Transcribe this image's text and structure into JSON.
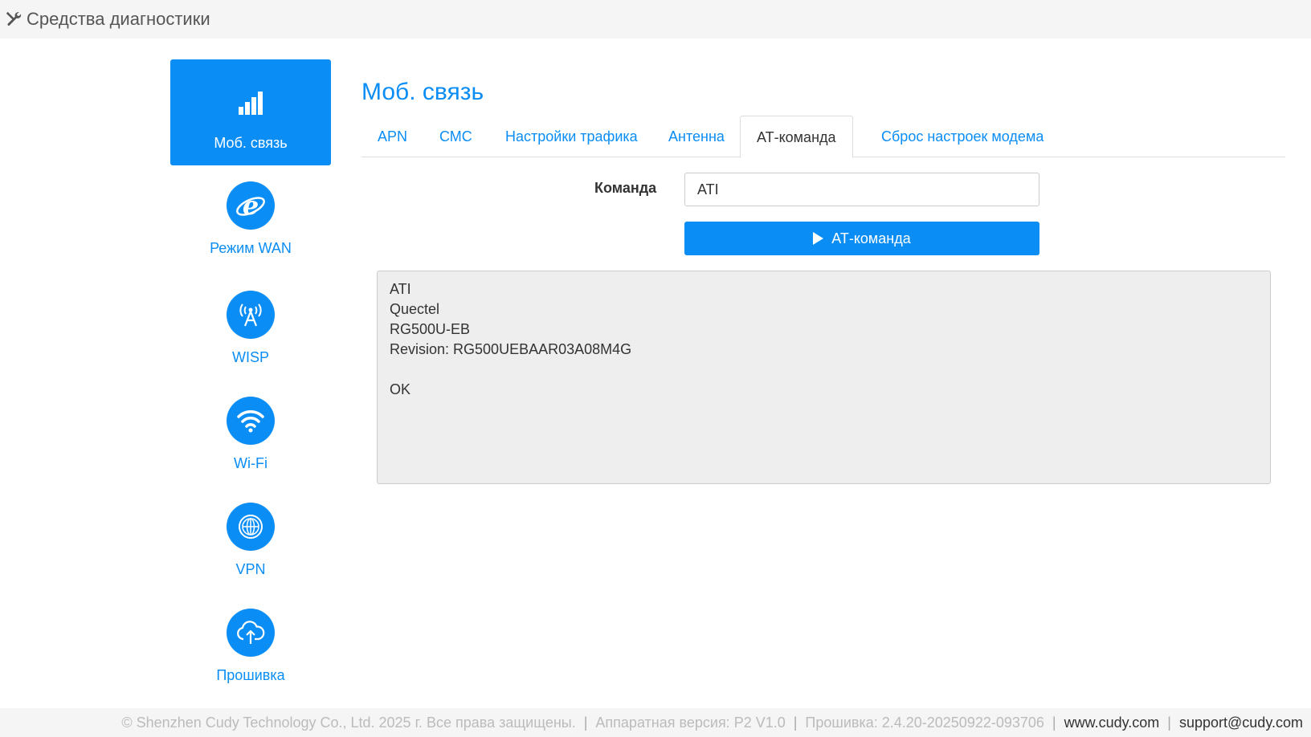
{
  "header": {
    "title": "Средства диагностики",
    "icon": "tools-icon"
  },
  "sidebar": {
    "items": [
      {
        "label": "Моб. связь",
        "icon": "signal-bars-icon",
        "active": true
      },
      {
        "label": "Режим WAN",
        "icon": "internet-explorer-icon"
      },
      {
        "label": "WISP",
        "icon": "antenna-tower-icon"
      },
      {
        "label": "Wi-Fi",
        "icon": "wifi-icon"
      },
      {
        "label": "VPN",
        "icon": "globe-icon"
      },
      {
        "label": "Прошивка",
        "icon": "cloud-upload-icon"
      }
    ]
  },
  "main": {
    "title": "Моб. связь",
    "tabs": [
      {
        "label": "APN"
      },
      {
        "label": "СМС"
      },
      {
        "label": "Настройки трафика"
      },
      {
        "label": "Антенна"
      },
      {
        "label": "АТ-команда",
        "active": true
      },
      {
        "label": "Сброс настроек модема"
      }
    ],
    "command_label": "Команда",
    "command_value": "ATI",
    "run_label": "АТ-команда",
    "output": "ATI\nQuectel\nRG500U-EB\nRevision: RG500UEBAAR03A08M4G\n\nOK"
  },
  "footer": {
    "copyright": "© Shenzhen Cudy Technology Co., Ltd. 2025 г. Все права защищены.",
    "hardware": "Аппаратная версия: P2 V1.0",
    "firmware": "Прошивка: 2.4.20-20250922-093706",
    "website": "www.cudy.com",
    "email": "support@cudy.com"
  },
  "colors": {
    "accent": "#0a8df5",
    "topbar_bg": "#f5f5f5",
    "output_bg": "#eeeeee"
  }
}
